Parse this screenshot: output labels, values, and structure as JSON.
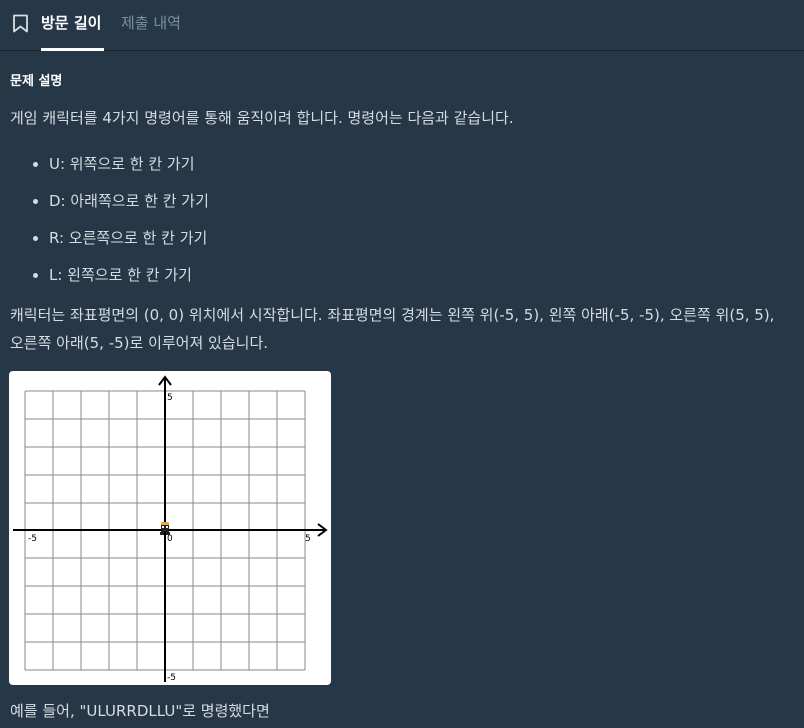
{
  "tabs": {
    "active_label": "방문 길이",
    "inactive_label": "제출 내역"
  },
  "icons": {
    "bookmark": "bookmark-icon"
  },
  "content": {
    "section_title": "문제 설명",
    "intro": "게임 캐릭터를 4가지 명령어를 통해 움직이려 합니다. 명령어는 다음과 같습니다.",
    "commands": [
      "U: 위쪽으로 한 칸 가기",
      "D: 아래쪽으로 한 칸 가기",
      "R: 오른쪽으로 한 칸 가기",
      "L: 왼쪽으로 한 칸 가기"
    ],
    "start_line1": "캐릭터는 좌표평면의 (0, 0) 위치에서 시작합니다. 좌표평면의 경계는 왼쪽 위(-5, 5), 왼쪽 아래(-5, -5), 오른쪽 위(5, 5),",
    "start_line2": "오른쪽 아래(5, -5)로 이루어져 있습니다.",
    "example_line": "예를 들어, \"ULURRDLLU\"로 명령했다면"
  },
  "figure": {
    "axis_labels": {
      "y_top": "5",
      "y_bottom": "-5",
      "x_left": "-5",
      "x_right": "5",
      "origin": "0"
    }
  },
  "colors": {
    "background": "#263747",
    "text": "#d6dce2",
    "active_tab": "#ffffff",
    "inactive_tab": "#78909c",
    "character": "#f2a33a"
  }
}
